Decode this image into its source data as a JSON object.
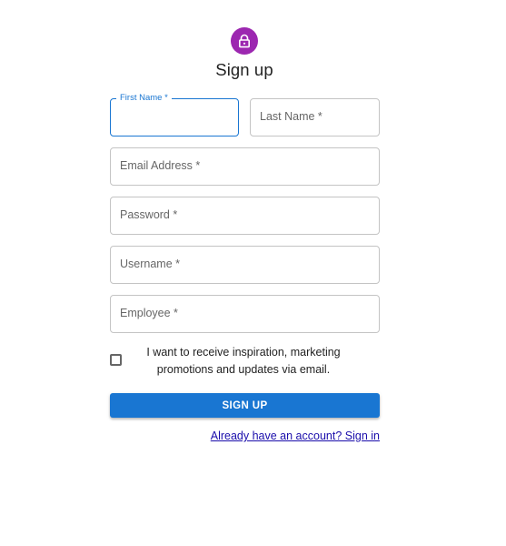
{
  "header": {
    "icon": "lock-icon",
    "icon_color": "#9c27b0",
    "title": "Sign up"
  },
  "form": {
    "first_name": {
      "label": "First Name *",
      "value": ""
    },
    "last_name": {
      "placeholder": "Last Name *",
      "value": ""
    },
    "email": {
      "placeholder": "Email Address *",
      "value": ""
    },
    "password": {
      "placeholder": "Password *",
      "value": ""
    },
    "username": {
      "placeholder": "Username *",
      "value": ""
    },
    "employee": {
      "placeholder": "Employee *",
      "value": ""
    },
    "consent": {
      "checked": false,
      "label": "I want to receive inspiration, marketing promotions and updates via email."
    },
    "submit_label": "SIGN UP",
    "signin_link": "Already have an account? Sign in"
  },
  "colors": {
    "primary": "#1976d2",
    "accent": "#9c27b0",
    "link": "#1a0dab"
  }
}
